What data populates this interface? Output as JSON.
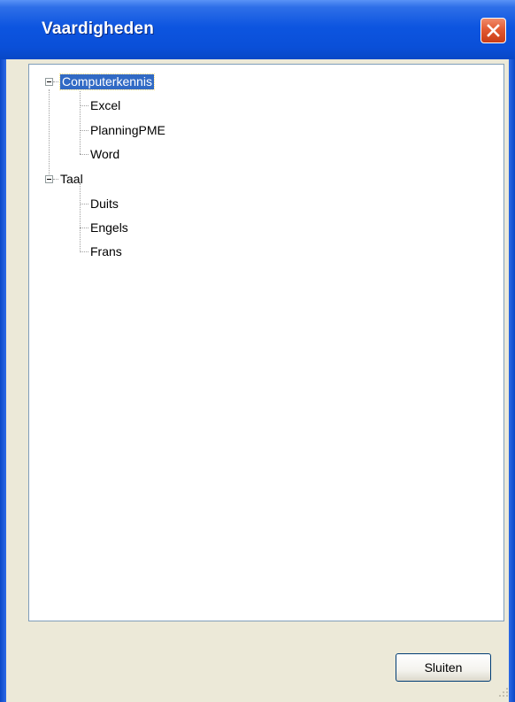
{
  "window": {
    "title": "Vaardigheden",
    "close_label": "×"
  },
  "tree": {
    "groups": [
      {
        "label": "Computerkennis",
        "expanded": true,
        "selected": true,
        "children": [
          "Excel",
          "PlanningPME",
          "Word"
        ]
      },
      {
        "label": "Taal",
        "expanded": true,
        "selected": false,
        "children": [
          "Duits",
          "Engels",
          "Frans"
        ]
      }
    ]
  },
  "footer": {
    "close_button_label": "Sluiten"
  },
  "colors": {
    "titlebar": "#0a4fd8",
    "selection": "#316ac5",
    "dialog_background": "#ece9d8",
    "close_button": "#e25a32"
  }
}
